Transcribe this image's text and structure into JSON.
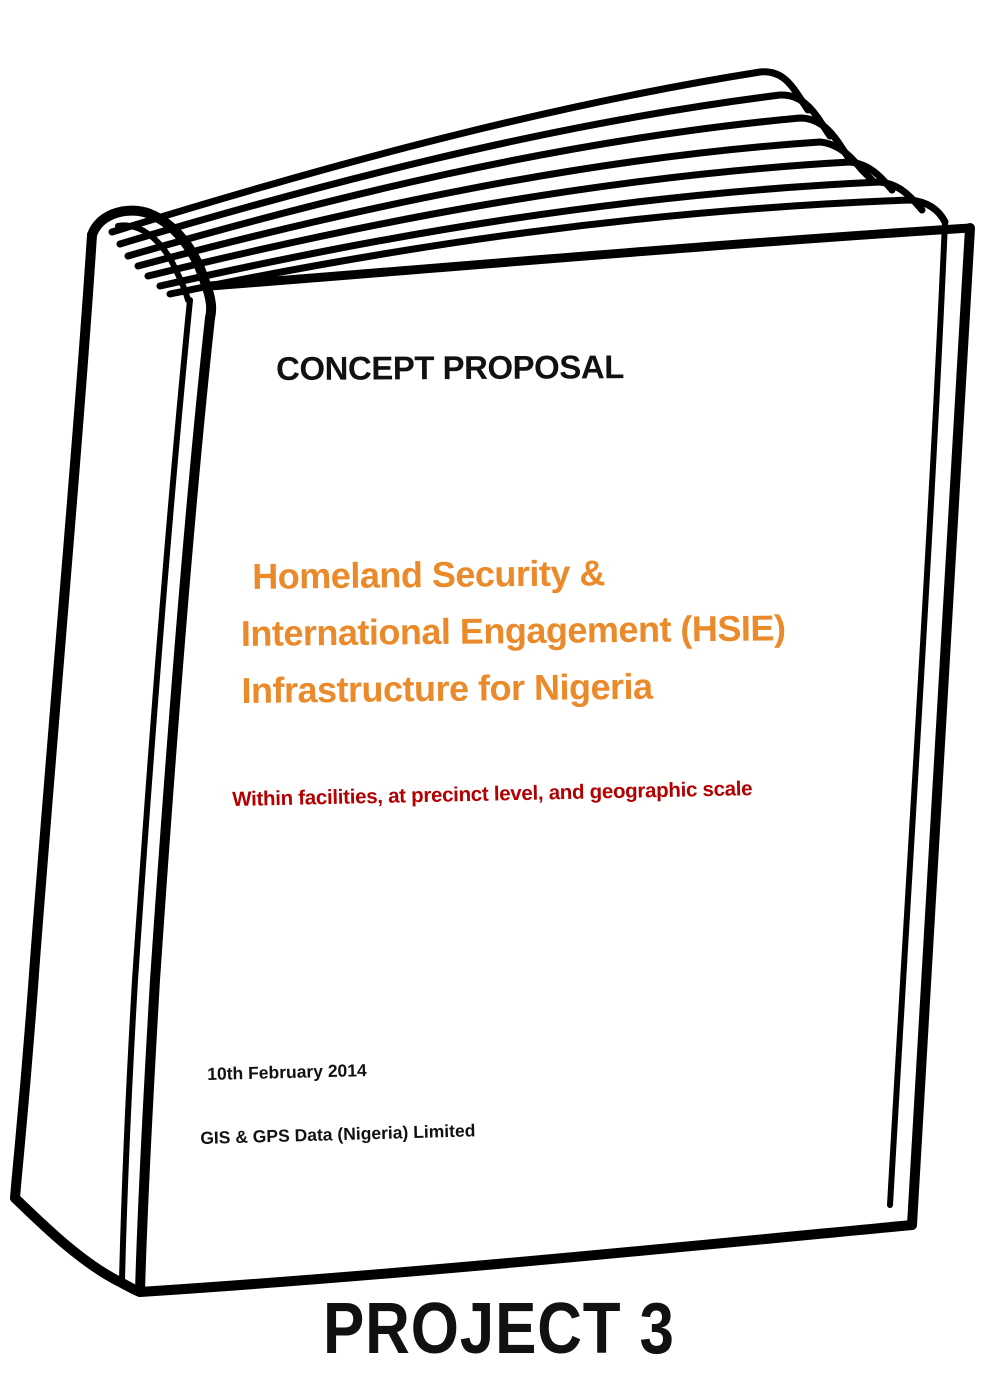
{
  "cover": {
    "doc_type": "CONCEPT PROPOSAL",
    "title_lines": [
      "Homeland Security &",
      "International Engagement (HSIE)",
      "Infrastructure for Nigeria"
    ],
    "subtitle": "Within facilities, at precinct level, and geographic scale",
    "date": "10th February 2014",
    "company": "GIS & GPS Data (Nigeria) Limited"
  },
  "caption": "PROJECT 3",
  "colors": {
    "title": "#ea8a2a",
    "subtitle": "#b30000",
    "text": "#111111",
    "outline": "#000000"
  },
  "illustration": "book-outline-icon"
}
